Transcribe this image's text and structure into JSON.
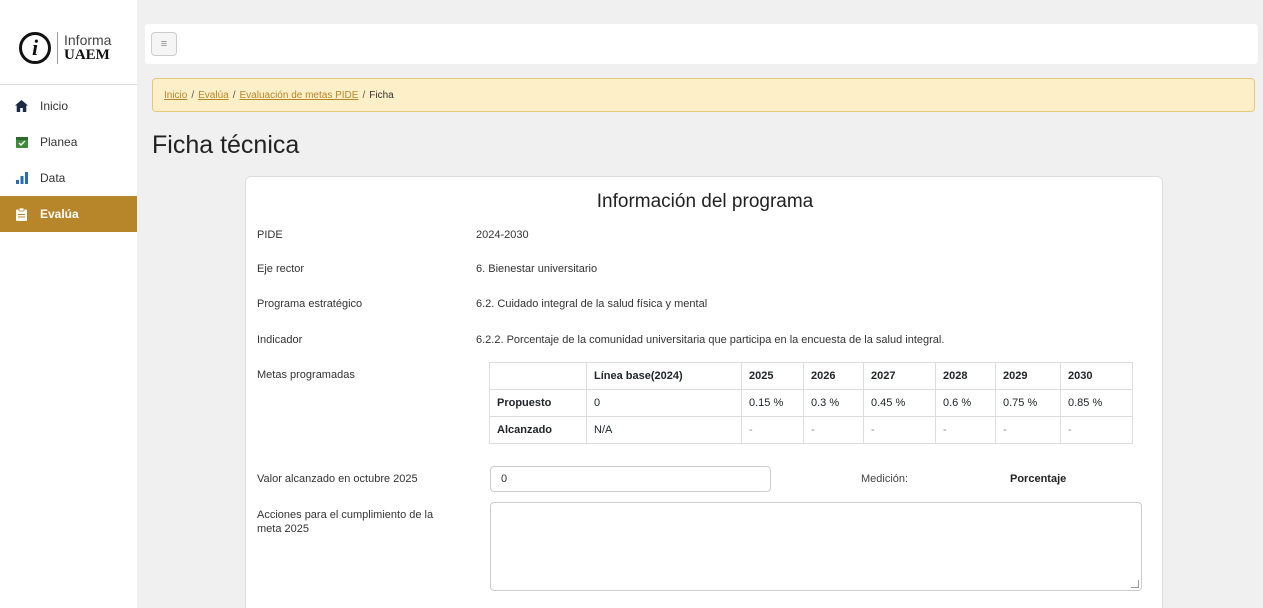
{
  "logo": {
    "line1": "Informa",
    "line2": "UAEM"
  },
  "nav": [
    {
      "label": "Inicio",
      "icon": "home-icon"
    },
    {
      "label": "Planea",
      "icon": "calendar-icon"
    },
    {
      "label": "Data",
      "icon": "bar-chart-icon"
    },
    {
      "label": "Evalúa",
      "icon": "clipboard-icon",
      "active": true
    }
  ],
  "topbar": {
    "menu_icon": "≡"
  },
  "breadcrumb": {
    "items": [
      "Inicio",
      "Evalúa",
      "Evaluación de metas PIDE"
    ],
    "current": "Ficha",
    "separator": "/"
  },
  "page_title": "Ficha técnica",
  "card": {
    "title": "Información del programa",
    "fields": [
      {
        "label": "PIDE",
        "value": "2024-2030"
      },
      {
        "label": "Eje rector",
        "value": "6. Bienestar universitario"
      },
      {
        "label": "Programa estratégico",
        "value": "6.2. Cuidado integral de la salud física y mental"
      },
      {
        "label": "Indicador",
        "value": "6.2.2. Porcentaje de la comunidad universitaria que participa en la encuesta de la salud integral."
      }
    ],
    "metas_label": "Metas programadas",
    "table": {
      "headers": [
        "",
        "Línea base(2024)",
        "2025",
        "2026",
        "2027",
        "2028",
        "2029",
        "2030"
      ],
      "rows": [
        [
          "Propuesto",
          "0",
          "0.15 %",
          "0.3 %",
          "0.45 %",
          "0.6 %",
          "0.75 %",
          "0.85 %"
        ],
        [
          "Alcanzado",
          "N/A",
          "-",
          "-",
          "-",
          "-",
          "-",
          "-"
        ]
      ]
    },
    "valor_label": "Valor alcanzado en octubre 2025",
    "valor_value": "0",
    "medicion_label": "Medición:",
    "medicion_value": "Porcentaje",
    "acciones_label": "Acciones para el cumplimiento de la meta 2025",
    "acciones_value": ""
  },
  "colors": {
    "accent": "#b8862a",
    "breadcrumb_bg": "#fdf0c8",
    "background": "#f0f0f0"
  }
}
